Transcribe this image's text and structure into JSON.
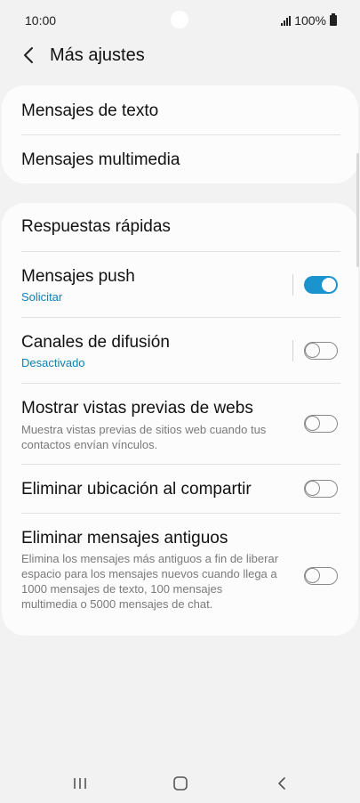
{
  "status_bar": {
    "time": "10:00",
    "battery": "100%"
  },
  "header": {
    "title": "Más ajustes"
  },
  "card1": {
    "items": [
      {
        "label": "Mensajes de texto"
      },
      {
        "label": "Mensajes multimedia"
      }
    ]
  },
  "card2": {
    "quick_replies": {
      "label": "Respuestas rápidas"
    },
    "push": {
      "label": "Mensajes push",
      "sub": "Solicitar",
      "enabled": true
    },
    "broadcast": {
      "label": "Canales de difusión",
      "sub": "Desactivado",
      "enabled": false
    },
    "previews": {
      "label": "Mostrar vistas previas de webs",
      "desc": "Muestra vistas previas de sitios web cuando tus contactos envían vínculos.",
      "enabled": false
    },
    "location": {
      "label": "Eliminar ubicación al compartir",
      "enabled": false
    },
    "old_messages": {
      "label": "Eliminar mensajes antiguos",
      "desc": "Elimina los mensajes más antiguos a fin de liberar espacio para los mensajes nuevos cuando llega a 1000 mensajes de texto, 100 mensajes multimedia o 5000 mensajes de chat.",
      "enabled": false
    }
  },
  "colors": {
    "accent": "#1b93cc",
    "background": "#f2f2f2",
    "card": "#fcfcfc"
  },
  "icons": {
    "back": "chevron-left-icon",
    "recents": "recents-icon",
    "home": "home-icon",
    "nav_back": "nav-back-icon"
  }
}
